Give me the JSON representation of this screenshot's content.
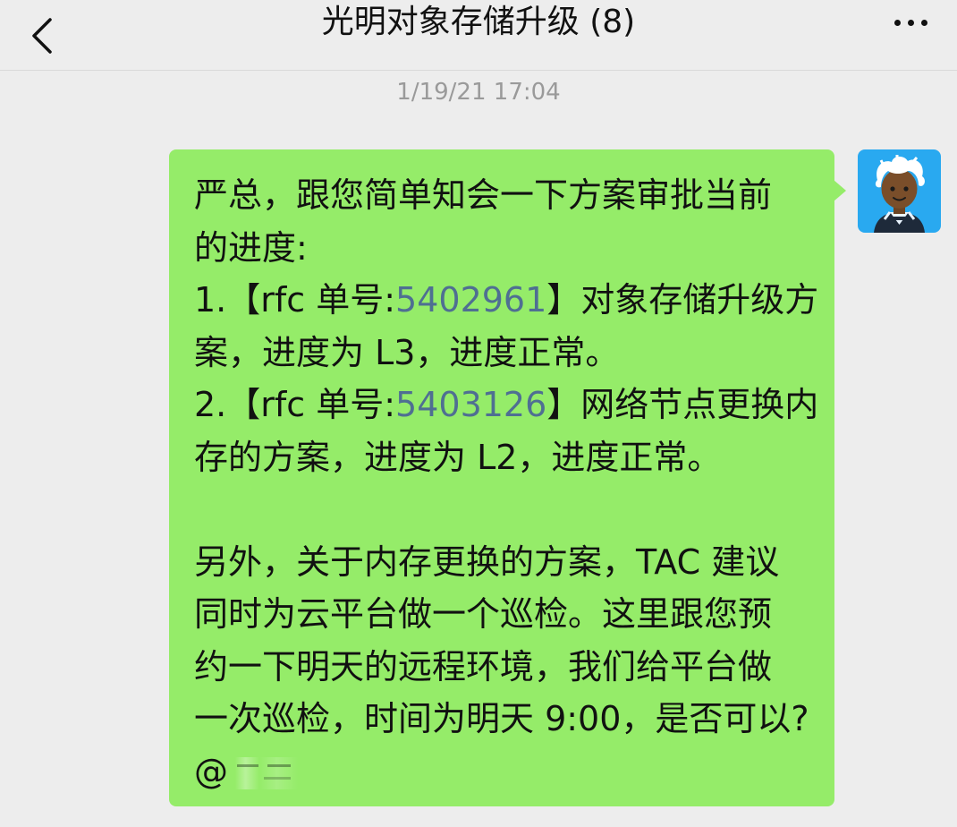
{
  "header": {
    "title": "光明对象存储升级 (8)"
  },
  "timestamp": "1/19/21 17:04",
  "message": {
    "lines": [
      {
        "text": "严总，跟您简单知会一下方案审批当前"
      },
      {
        "text": "的进度:"
      },
      {
        "pre": "1.【rfc 单号:",
        "link": "5402961",
        "post": "】对象存储升级方"
      },
      {
        "text": "案，进度为 L3，进度正常。"
      },
      {
        "pre": "2.【rfc 单号:",
        "link": "5403126",
        "post": "】网络节点更换内"
      },
      {
        "text": "存的方案，进度为 L2，进度正常。"
      },
      {
        "text": ""
      },
      {
        "text": "另外，关于内存更换的方案，TAC 建议"
      },
      {
        "text": "同时为云平台做一个巡检。这里跟您预"
      },
      {
        "text": "约一下明天的远程环境，我们给平台做"
      },
      {
        "text": "一次巡检，时间为明天 9:00，是否可以?"
      },
      {
        "mention": "@"
      }
    ]
  },
  "colors": {
    "bubble": "#95ec69",
    "link": "#4f6f92",
    "background": "#ededed",
    "avatar_bg": "#29a9f0"
  }
}
